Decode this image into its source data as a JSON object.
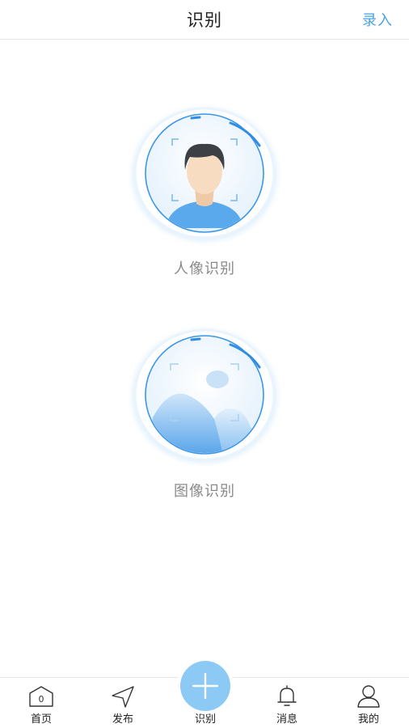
{
  "header": {
    "title": "识别",
    "action_label": "录入"
  },
  "cards": [
    {
      "label": "人像识别",
      "icon": "face-recognition-icon"
    },
    {
      "label": "图像识别",
      "icon": "image-recognition-icon"
    }
  ],
  "tabbar": {
    "items": [
      {
        "label": "首页",
        "icon": "home-icon",
        "badge": "0"
      },
      {
        "label": "发布",
        "icon": "send-icon"
      },
      {
        "label": "识别",
        "icon": "plus-icon"
      },
      {
        "label": "消息",
        "icon": "bell-icon"
      },
      {
        "label": "我的",
        "icon": "user-icon"
      }
    ]
  },
  "colors": {
    "accent": "#4aa3e0",
    "fab": "#8ccaf5",
    "ring": "#2f8de4"
  }
}
